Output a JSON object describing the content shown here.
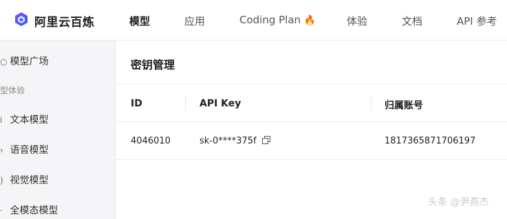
{
  "app": {
    "brand": "阿里云百炼"
  },
  "nav": {
    "items": [
      {
        "label": "模型",
        "active": true
      },
      {
        "label": "应用"
      },
      {
        "label": "Coding Plan"
      },
      {
        "label": "体验"
      },
      {
        "label": "文档"
      },
      {
        "label": "API 参考"
      }
    ],
    "coding_plan_icon": "🔥"
  },
  "sidebar": {
    "model_square": "模型广场",
    "group_label": "型体验",
    "items": [
      {
        "label": "文本模型",
        "icon": "text-icon"
      },
      {
        "label": "语音模型",
        "icon": "voice-icon"
      },
      {
        "label": "视觉模型",
        "icon": "vision-icon"
      },
      {
        "label": "全模态模型",
        "icon": "omni-icon"
      }
    ]
  },
  "panel": {
    "title": "密钥管理",
    "table": {
      "headers": [
        "ID",
        "API Key",
        "归属账号"
      ],
      "rows": [
        {
          "id": "4046010",
          "api_key": "sk-0****375f",
          "account": "1817365871706197"
        }
      ]
    }
  },
  "watermark": "头条 @尹燕杰",
  "colors": {
    "accent": "#4c3cf0",
    "active_text": "#1f1f1f"
  }
}
